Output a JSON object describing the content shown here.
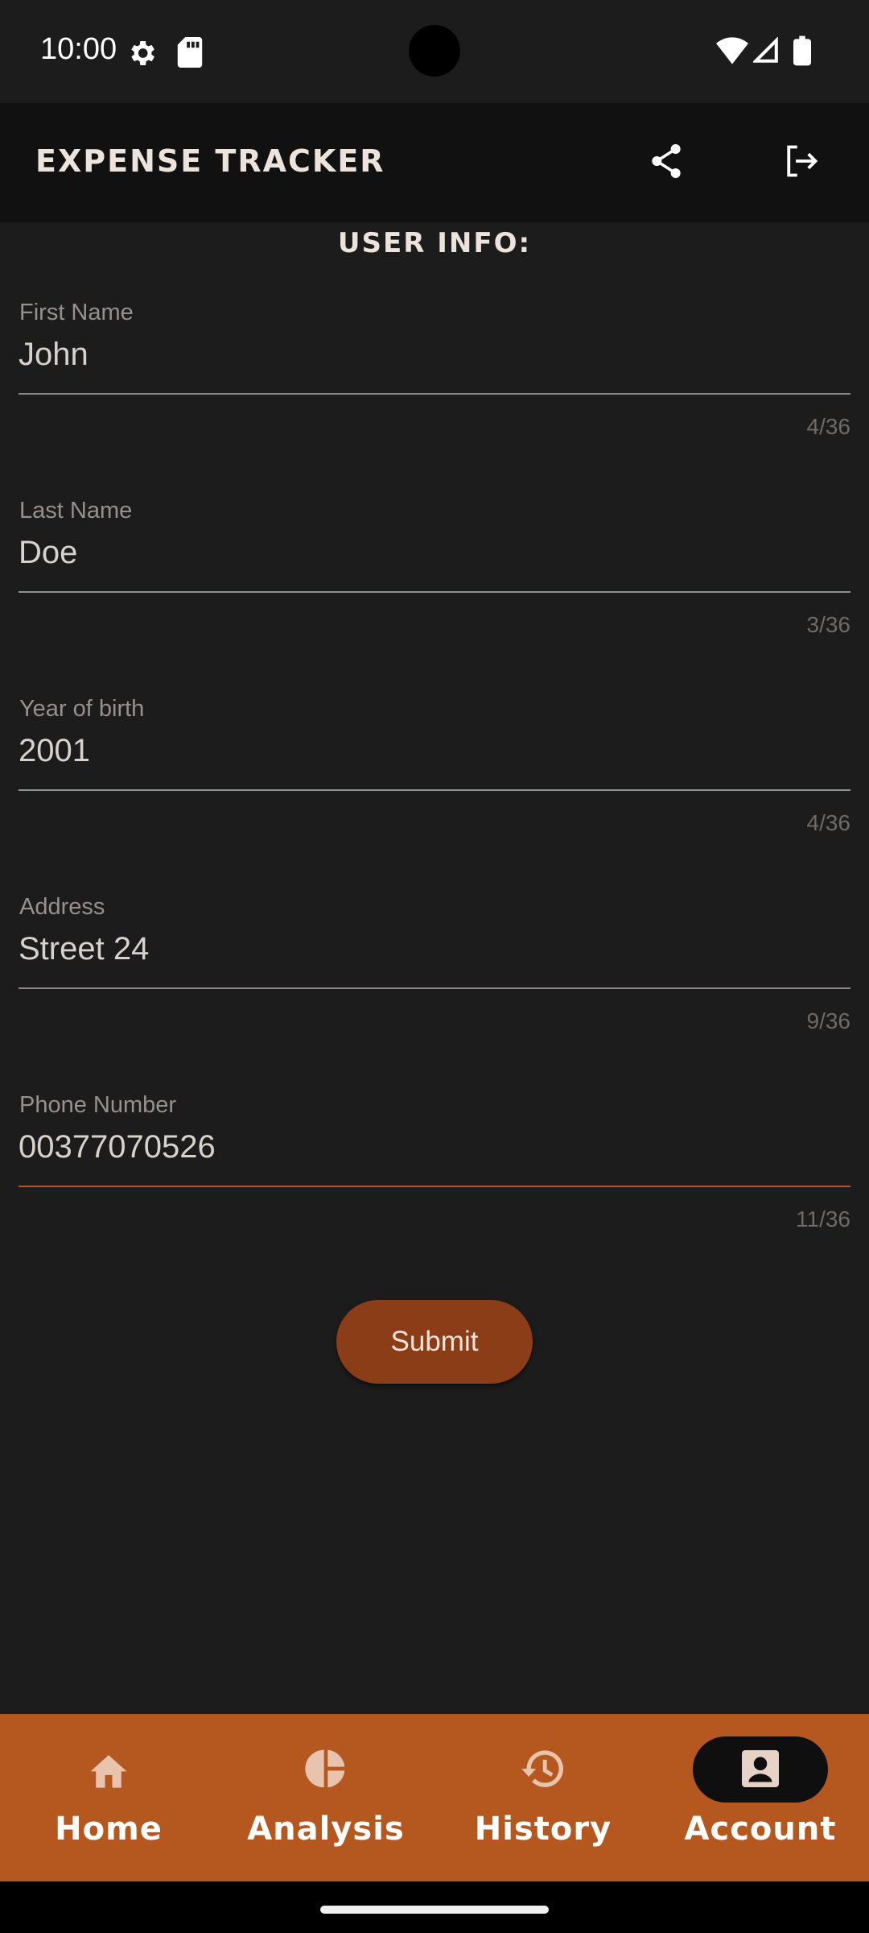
{
  "status_bar": {
    "time": "10:00",
    "icons": [
      "settings-gear-icon",
      "sd-card-icon",
      "wifi-icon",
      "signal-icon",
      "battery-icon"
    ]
  },
  "app_bar": {
    "title": "EXPENSE TRACKER",
    "actions": [
      "share-icon",
      "logout-icon"
    ]
  },
  "section": {
    "title": "USER INFO:"
  },
  "form": {
    "first_name": {
      "label": "First Name",
      "value": "John",
      "counter": "4/36"
    },
    "last_name": {
      "label": "Last Name",
      "value": "Doe",
      "counter": "3/36"
    },
    "year_of_birth": {
      "label": "Year of birth",
      "value": "2001",
      "counter": "4/36"
    },
    "address": {
      "label": "Address",
      "value": "Street 24",
      "counter": "9/36"
    },
    "phone": {
      "label": "Phone Number",
      "value": "00377070526",
      "counter": "11/36"
    },
    "submit_label": "Submit"
  },
  "bottom_nav": {
    "selected": "Account",
    "items": [
      {
        "label": "Home",
        "icon": "home-icon"
      },
      {
        "label": "Analysis",
        "icon": "pie-chart-icon"
      },
      {
        "label": "History",
        "icon": "history-icon"
      },
      {
        "label": "Account",
        "icon": "account-box-icon"
      }
    ]
  },
  "colors": {
    "accent": "#b5581f",
    "button": "#8a3d17",
    "background": "#1c1c1d"
  }
}
